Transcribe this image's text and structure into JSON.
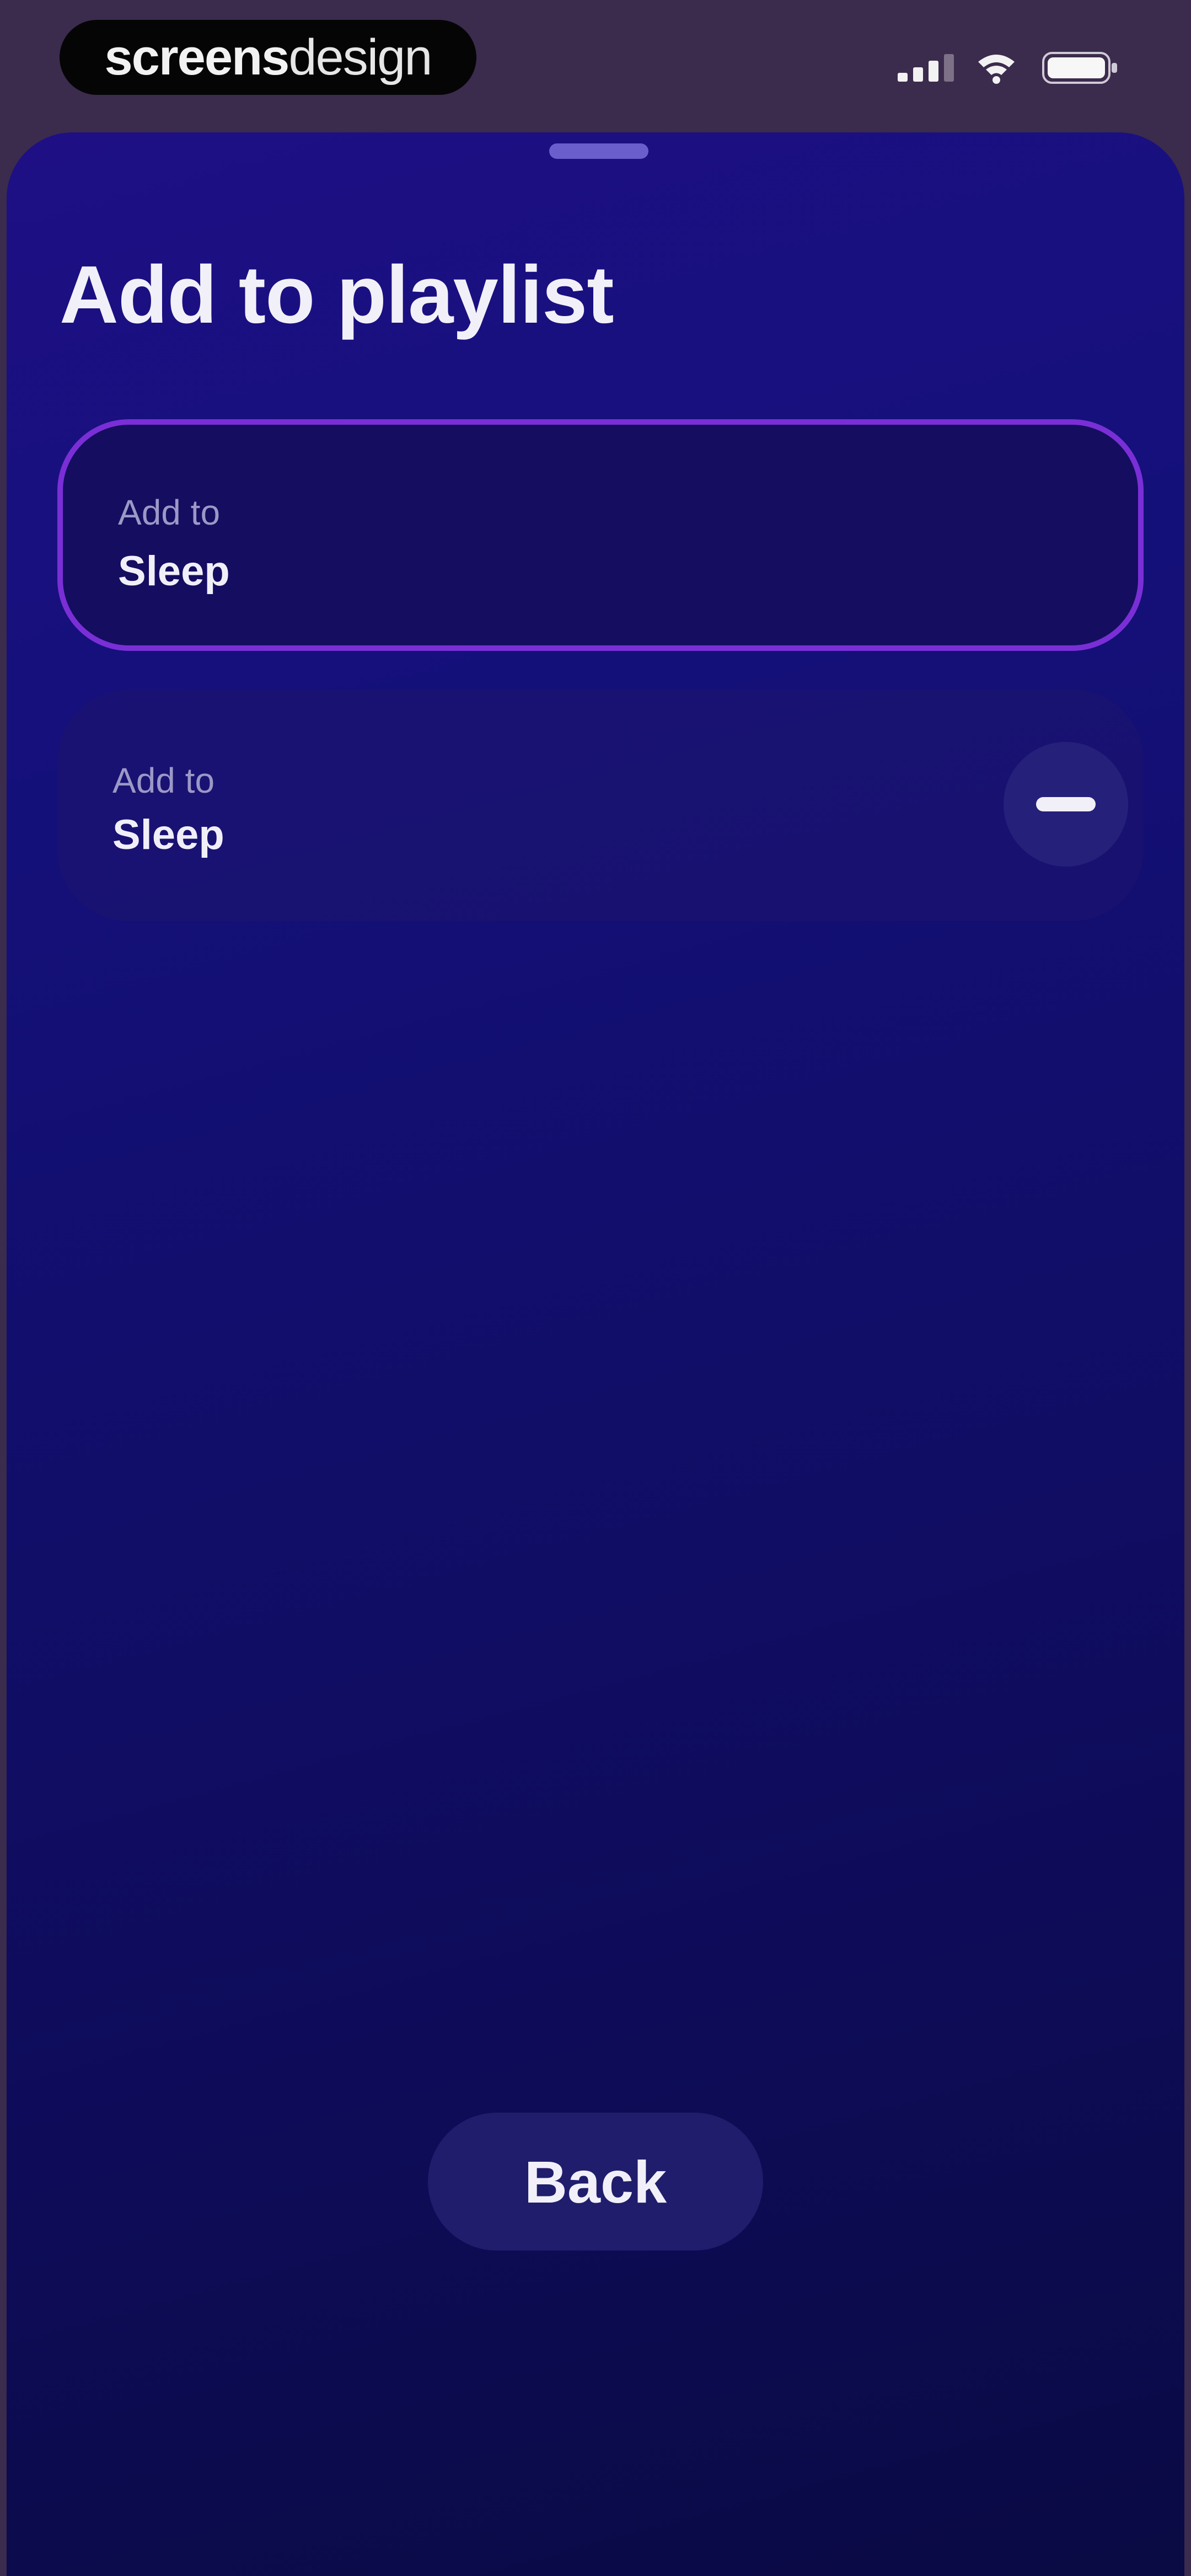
{
  "status_bar": {
    "brand_bold": "screens",
    "brand_light": "design",
    "icons": [
      "signal-icon",
      "wifi-icon",
      "battery-icon"
    ]
  },
  "sheet": {
    "title": "Add to playlist",
    "items": [
      {
        "label": "Add to",
        "name": "Sleep",
        "selected": true
      },
      {
        "label": "Add to",
        "name": "Sleep",
        "selected": false,
        "action_icon": "minus-icon"
      }
    ],
    "back_label": "Back"
  },
  "colors": {
    "background_top": "#1e0f85",
    "background_bottom": "#0a0a44",
    "accent_border": "#7a2fd6",
    "status_bar": "#3b2b4d",
    "text_primary": "#f1f0f8",
    "text_secondary": "#9c98c7"
  }
}
